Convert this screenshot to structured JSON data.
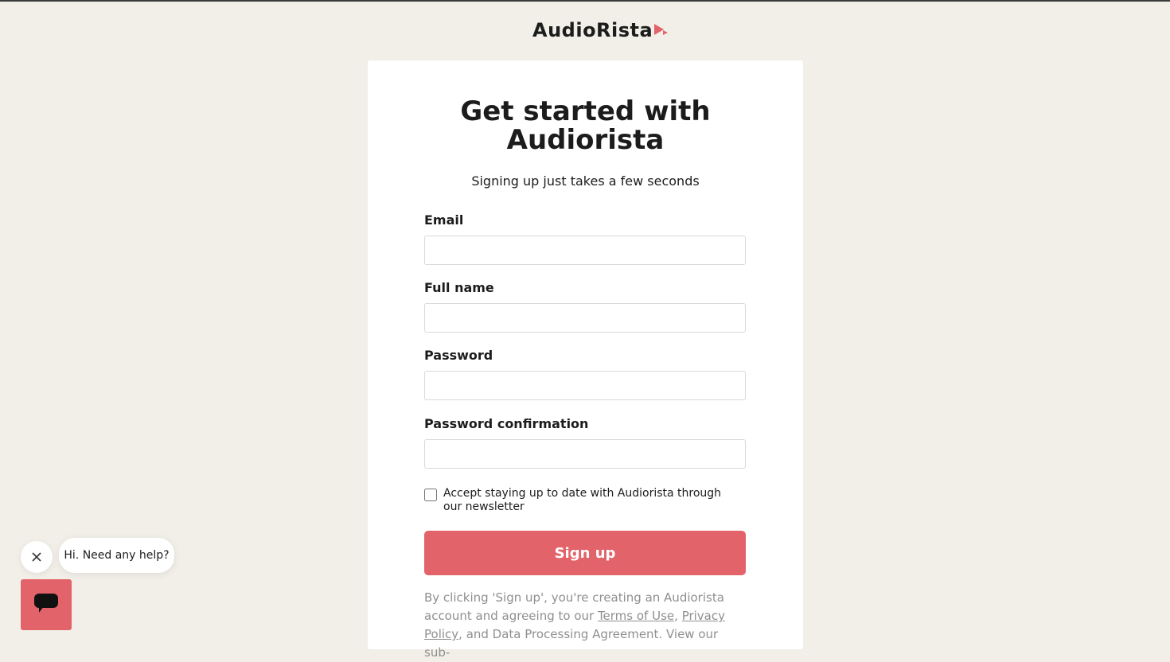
{
  "brand": {
    "logo_text": "AudioRista",
    "accent_color": "#e3636a",
    "background_color": "#f1efe8"
  },
  "form": {
    "title_line1": "Get started with",
    "title_line2": "Audiorista",
    "subtitle": "Signing up just takes a few seconds",
    "email": {
      "label": "Email",
      "value": ""
    },
    "full_name": {
      "label": "Full name",
      "value": ""
    },
    "password": {
      "label": "Password",
      "value": ""
    },
    "password_confirmation": {
      "label": "Password confirmation",
      "value": ""
    },
    "newsletter": {
      "label": "Accept staying up to date with Audiorista through our newsletter",
      "checked": false
    },
    "signup_button_label": "Sign up",
    "legal": {
      "text_before": "By clicking 'Sign up', you're creating an Audiorista account and agreeing to our ",
      "terms_link": "Terms of Use",
      "separator": ", ",
      "privacy_link": "Privacy Policy",
      "text_after": ", and Data Processing Agreement. View our sub-"
    }
  },
  "chat_widget": {
    "greeting": "Hi. Need any help?",
    "close_icon": "close-icon",
    "launcher_icon": "chat-bubble-icon"
  }
}
